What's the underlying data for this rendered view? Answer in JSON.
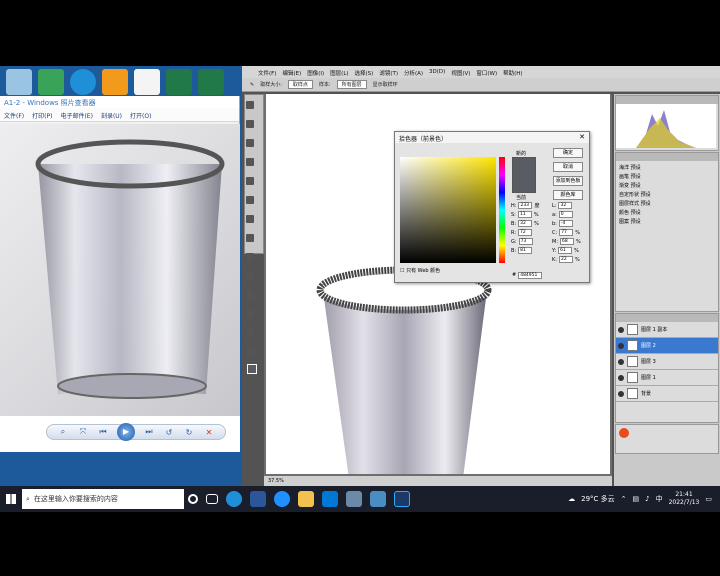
{
  "viewer": {
    "title": "A1-2 - Windows 照片查看器",
    "menu": [
      "文件(F)",
      "打印(P)",
      "电子邮件(E)",
      "刻录(U)",
      "打开(O)"
    ]
  },
  "photoshop": {
    "menu": [
      "文件(F)",
      "编辑(E)",
      "图像(I)",
      "图层(L)",
      "选择(S)",
      "滤镜(T)",
      "分析(A)",
      "3D(D)",
      "视图(V)",
      "窗口(W)",
      "帮助(H)"
    ],
    "options": {
      "sample_size": "取样大小:",
      "sample_value": "取样点",
      "sample_label": "样本:",
      "sample_all": "所有图层",
      "show_ring": "显示取样环"
    },
    "status": "37.5%",
    "layers": [
      {
        "name": "图层 1 副本",
        "active": false
      },
      {
        "name": "图层 2",
        "active": true
      },
      {
        "name": "图层 3",
        "active": false
      },
      {
        "name": "图层 1",
        "active": false
      },
      {
        "name": "背景",
        "active": false
      }
    ],
    "history_items": [
      "海洋 预设",
      "画笔 预设",
      "渐变 预设",
      "自定形状 预设",
      "图层样式 预设",
      "颜色 预设",
      "图案 预设"
    ]
  },
  "picker": {
    "title": "拾色器（前景色）",
    "buttons": [
      "确定",
      "取消",
      "添加到色板",
      "颜色库"
    ],
    "new_label": "新的",
    "current_label": "当前",
    "fields": [
      {
        "label": "H:",
        "value": "233",
        "unit": "度"
      },
      {
        "label": "L:",
        "value": "32"
      },
      {
        "label": "S:",
        "value": "11",
        "unit": "%"
      },
      {
        "label": "a:",
        "value": "0"
      },
      {
        "label": "B:",
        "value": "32",
        "unit": "%"
      },
      {
        "label": "b:",
        "value": "-4"
      },
      {
        "label": "R:",
        "value": "72"
      },
      {
        "label": "C:",
        "value": "77",
        "unit": "%"
      },
      {
        "label": "G:",
        "value": "73"
      },
      {
        "label": "M:",
        "value": "68",
        "unit": "%"
      },
      {
        "label": "B:",
        "value": "81"
      },
      {
        "label": "Y:",
        "value": "61",
        "unit": "%"
      },
      {
        "label": "",
        "value": ""
      },
      {
        "label": "K:",
        "value": "22",
        "unit": "%"
      }
    ],
    "web_only": "只有 Web 颜色",
    "hex": "484951",
    "new_color": "#5a5c63"
  },
  "taskbar": {
    "search_placeholder": "在这里输入你要搜索的内容",
    "weather": "29°C 多云",
    "time": "21:41",
    "date": "2022/7/13"
  },
  "colors": {
    "taskbar": "#1a1d2a",
    "desktop": "#1d5a9c",
    "ps_bg": "#535353"
  }
}
